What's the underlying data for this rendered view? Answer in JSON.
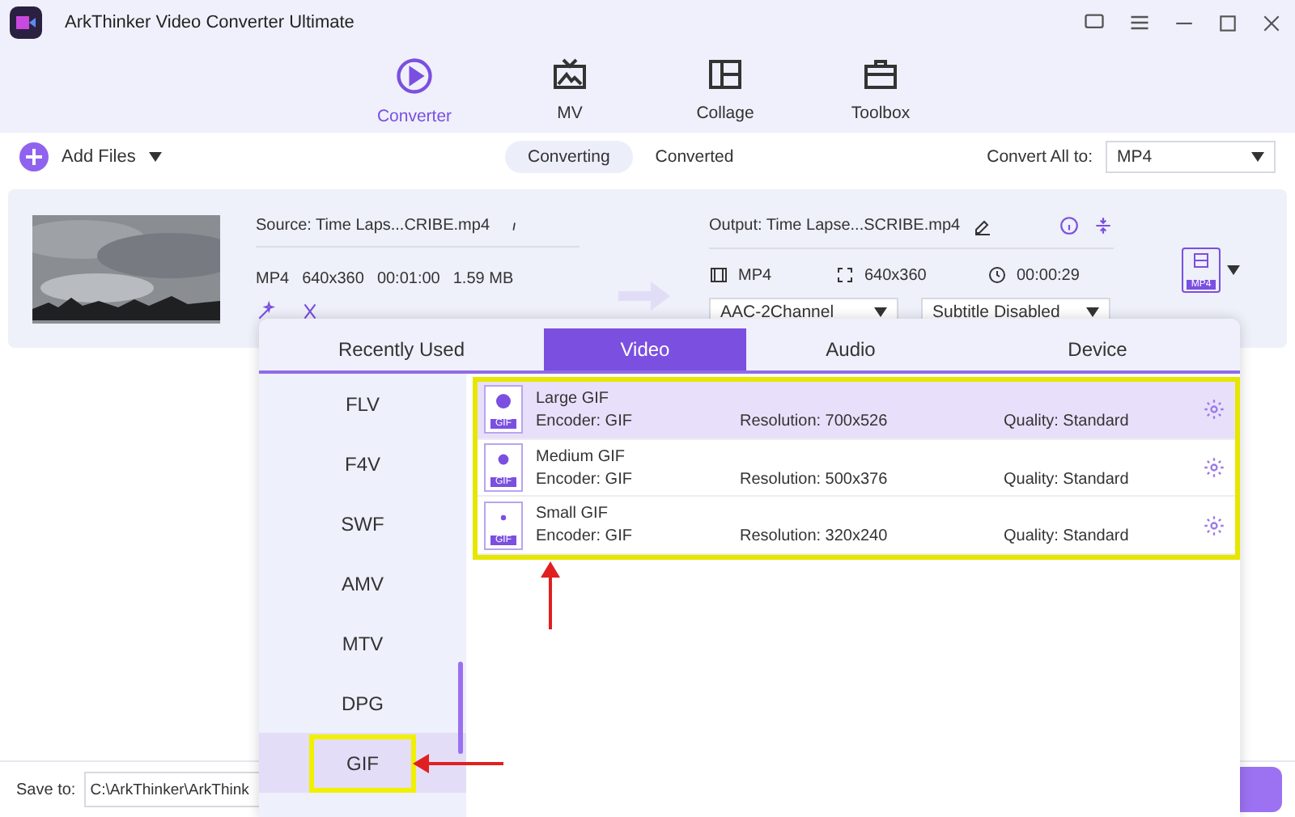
{
  "window": {
    "title": "ArkThinker Video Converter Ultimate"
  },
  "nav": [
    {
      "label": "Converter",
      "kind": "converter",
      "selected": true
    },
    {
      "label": "MV",
      "kind": "mv",
      "selected": false
    },
    {
      "label": "Collage",
      "kind": "collage",
      "selected": false
    },
    {
      "label": "Toolbox",
      "kind": "toolbox",
      "selected": false
    }
  ],
  "toolbar": {
    "add_files": "Add Files",
    "tabs": [
      {
        "label": "Converting",
        "selected": true
      },
      {
        "label": "Converted",
        "selected": false
      }
    ],
    "convert_all_label": "Convert All to:",
    "convert_all_value": "MP4"
  },
  "file": {
    "source": "Source: Time Laps...CRIBE.mp4",
    "format": "MP4",
    "resolution": "640x360",
    "duration": "00:01:00",
    "size": "1.59 MB",
    "output": "Output: Time Lapse...SCRIBE.mp4",
    "out_format": "MP4",
    "out_resolution": "640x360",
    "out_duration": "00:00:29",
    "audio": "AAC-2Channel",
    "subtitle": "Subtitle Disabled",
    "badge": "MP4"
  },
  "popup": {
    "tabs": [
      {
        "label": "Recently Used",
        "selected": false
      },
      {
        "label": "Video",
        "selected": true
      },
      {
        "label": "Audio",
        "selected": false
      },
      {
        "label": "Device",
        "selected": false
      }
    ],
    "formats": [
      {
        "label": "FLV",
        "selected": false,
        "highlighted": false
      },
      {
        "label": "F4V",
        "selected": false,
        "highlighted": false
      },
      {
        "label": "SWF",
        "selected": false,
        "highlighted": false
      },
      {
        "label": "AMV",
        "selected": false,
        "highlighted": false
      },
      {
        "label": "MTV",
        "selected": false,
        "highlighted": false
      },
      {
        "label": "DPG",
        "selected": false,
        "highlighted": false
      },
      {
        "label": "GIF",
        "selected": true,
        "highlighted": true
      }
    ],
    "presets_highlighted": true,
    "presets": [
      {
        "name": "Large GIF",
        "kind": "large",
        "badge": "GIF",
        "encoder": "Encoder: GIF",
        "resolution": "Resolution: 700x526",
        "quality": "Quality: Standard",
        "selected": true
      },
      {
        "name": "Medium GIF",
        "kind": "medium",
        "badge": "GIF",
        "encoder": "Encoder: GIF",
        "resolution": "Resolution: 500x376",
        "quality": "Quality: Standard",
        "selected": false
      },
      {
        "name": "Small GIF",
        "kind": "small",
        "badge": "GIF",
        "encoder": "Encoder: GIF",
        "resolution": "Resolution: 320x240",
        "quality": "Quality: Standard",
        "selected": false
      }
    ]
  },
  "bottom": {
    "save_label": "Save to:",
    "path": "C:\\ArkThinker\\ArkThink"
  }
}
